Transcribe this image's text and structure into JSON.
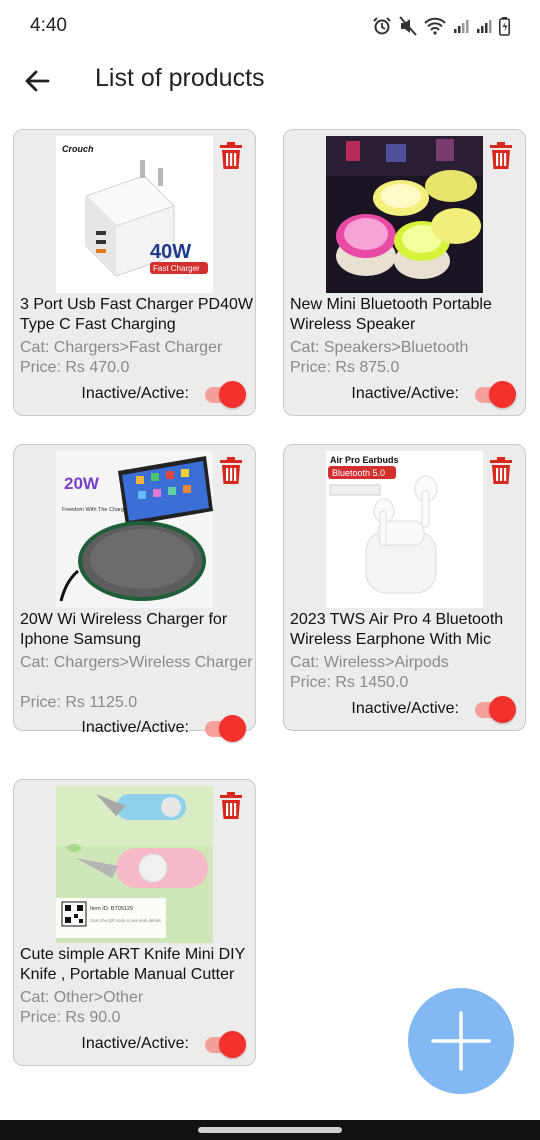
{
  "status_bar": {
    "time": "4:40"
  },
  "app_bar": {
    "title": "List of products"
  },
  "toggle_label": "Inactive/Active:",
  "products": [
    {
      "name": "3 Port Usb Fast Charger PD40W Type C Fast Charging",
      "category": "Cat: Chargers>Fast Charger",
      "price": "Price: Rs 470.0",
      "active": true,
      "thumb_text": {
        "brand": "Crouch",
        "watt": "40W",
        "badge": "Fast Charger"
      }
    },
    {
      "name": "New Mini Bluetooth Portable Wireless Speaker",
      "category": "Cat: Speakers>Bluetooth",
      "price": "Price: Rs 875.0",
      "active": true
    },
    {
      "name": "20W Wi Wireless Charger for Iphone Samsung",
      "category": "Cat: Chargers>Wireless Charger",
      "price": "Price: Rs 1125.0",
      "active": true,
      "thumb_text": {
        "watt": "20W",
        "tagline": "Freedom With The Charge"
      }
    },
    {
      "name": "2023 TWS Air Pro 4 Bluetooth Wireless Earphone With Mic",
      "category": "Cat: Wireless>Airpods",
      "price": "Price: Rs 1450.0",
      "active": true,
      "thumb_text": {
        "heading": "Air Pro Earbuds",
        "badge": "Bluetooth 5.0"
      }
    },
    {
      "name": "Cute simple ART Knife Mini DIY Knife , Portable Manual Cutter",
      "category": "Cat: Other>Other",
      "price": "Price: Rs 90.0",
      "active": true,
      "thumb_text": {
        "item_id": "Item ID: BT05129",
        "scan": "Scan the QR code to see item details"
      }
    }
  ],
  "colors": {
    "accent_red": "#f2312c",
    "delete_red": "#d8271c",
    "fab_blue": "#82b8f4",
    "card_bg": "#ececec"
  },
  "icons": {
    "back": "arrow-left-icon",
    "delete": "trash-icon",
    "add": "plus-icon"
  }
}
